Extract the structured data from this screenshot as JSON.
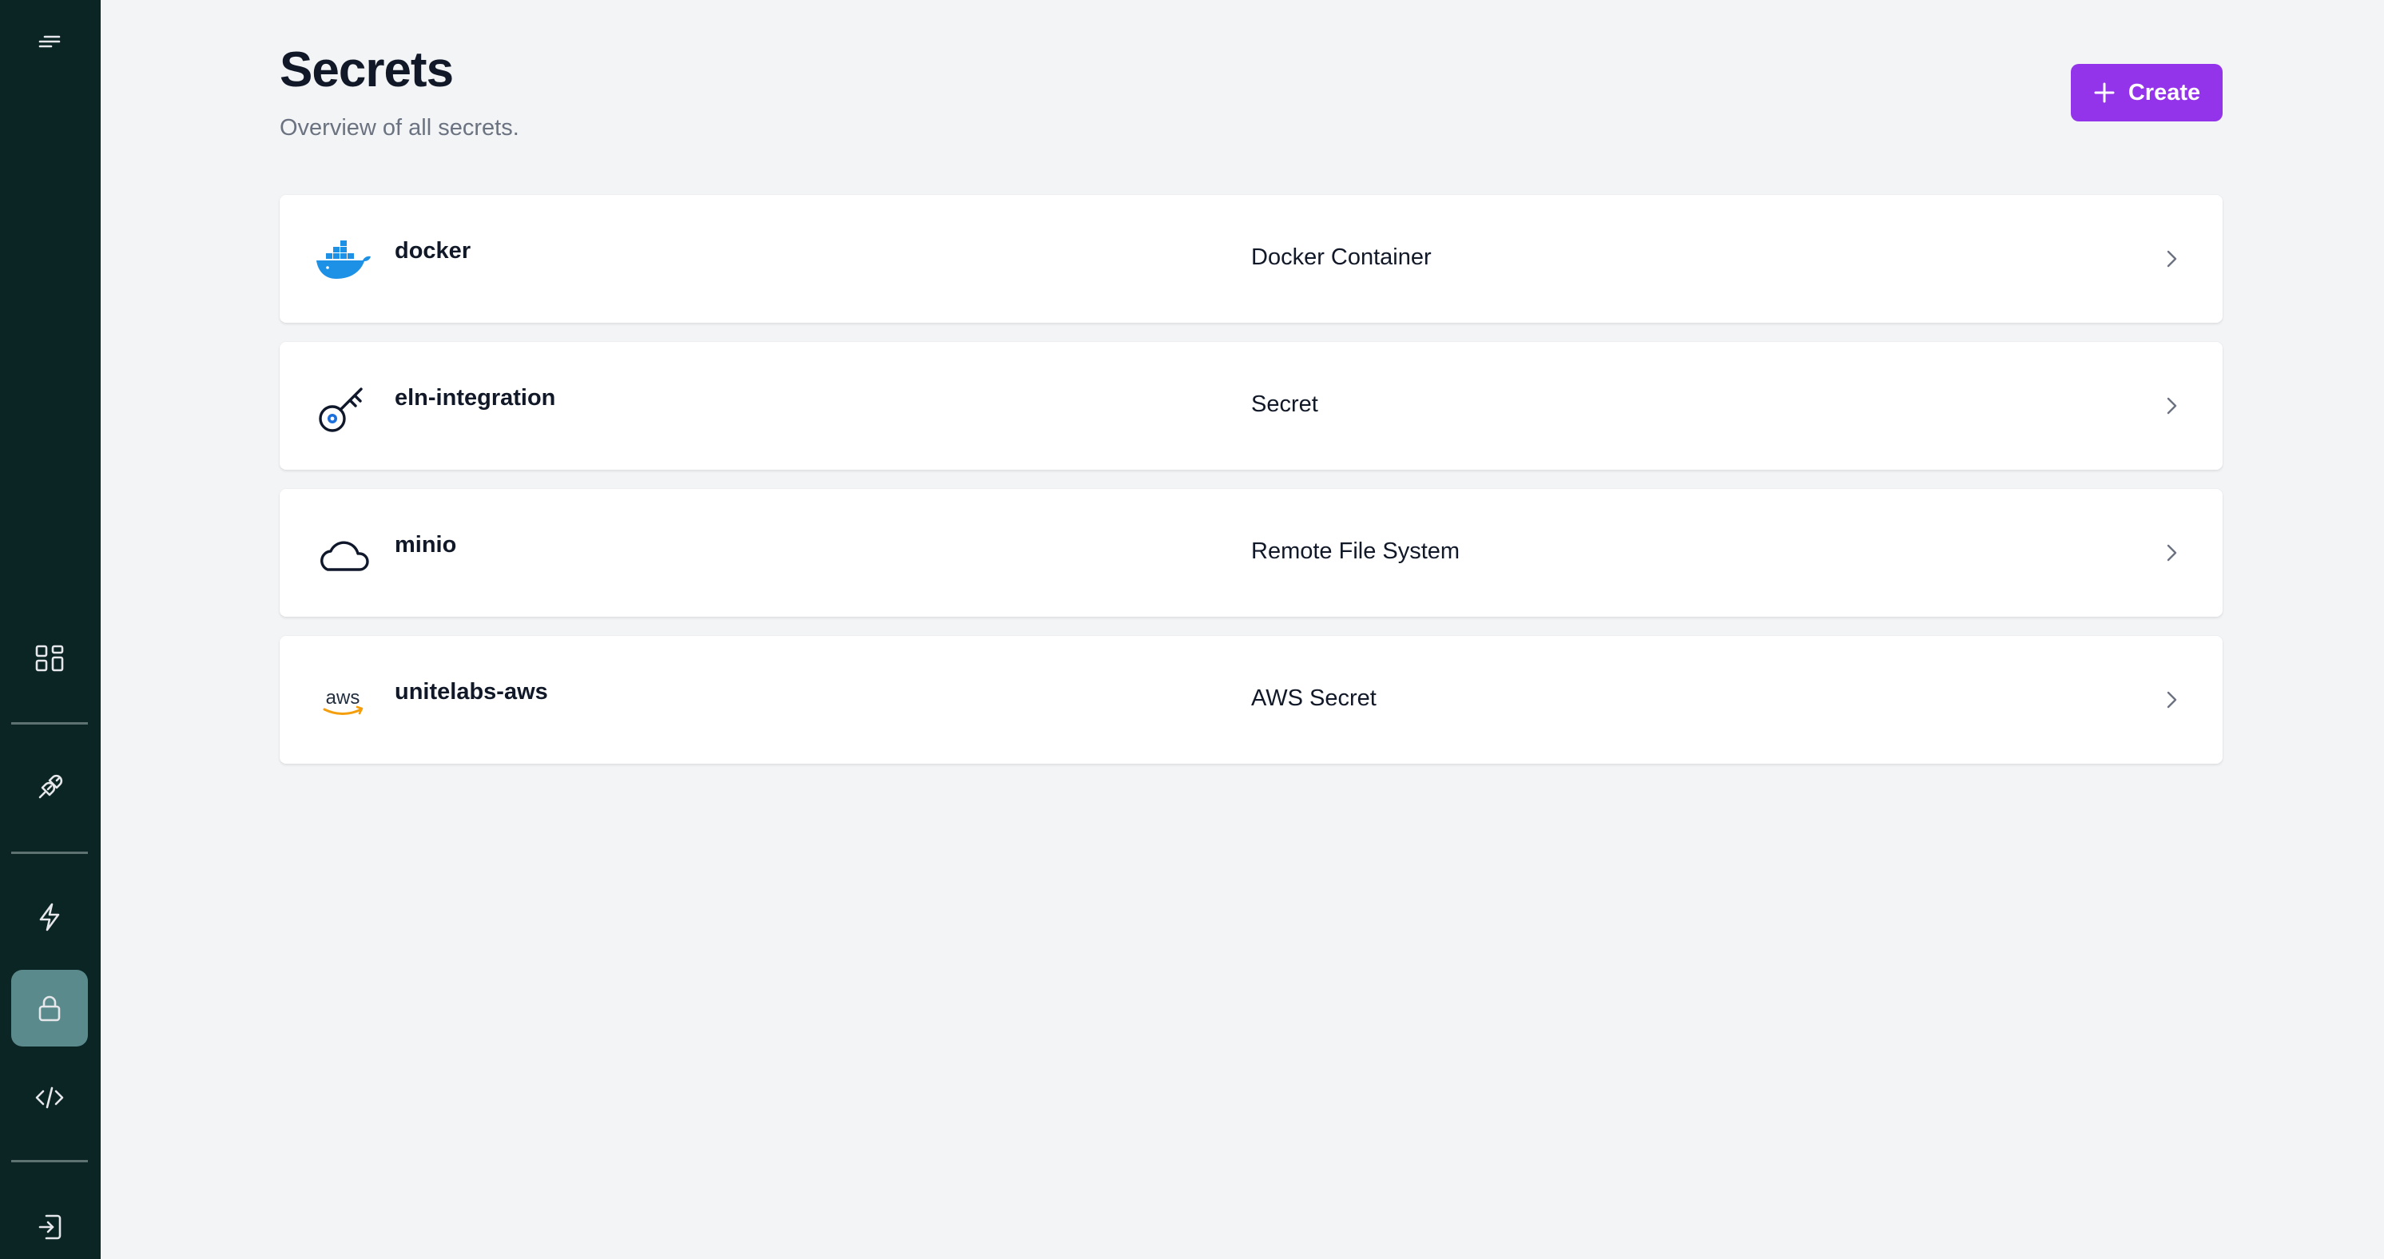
{
  "page": {
    "title": "Secrets",
    "subtitle": "Overview of all secrets.",
    "create_label": "Create"
  },
  "sidebar": {
    "items": [
      {
        "icon": "menu-icon",
        "active": false
      },
      {
        "icon": "dashboard-icon",
        "active": false
      },
      {
        "icon": "plug-icon",
        "active": false
      },
      {
        "icon": "lightning-icon",
        "active": false
      },
      {
        "icon": "lock-icon",
        "active": true
      },
      {
        "icon": "code-icon",
        "active": false
      },
      {
        "icon": "logout-icon",
        "active": false
      }
    ]
  },
  "secrets": [
    {
      "name": "docker",
      "type": "Docker Container",
      "icon": "docker-icon"
    },
    {
      "name": "eln-integration",
      "type": "Secret",
      "icon": "key-icon"
    },
    {
      "name": "minio",
      "type": "Remote File System",
      "icon": "cloud-icon"
    },
    {
      "name": "unitelabs-aws",
      "type": "AWS Secret",
      "icon": "aws-icon",
      "icon_text": "aws"
    }
  ],
  "colors": {
    "sidebar_bg": "#0b2424",
    "sidebar_active": "#5a8a8c",
    "accent": "#9333ea",
    "page_bg": "#f3f4f6"
  }
}
